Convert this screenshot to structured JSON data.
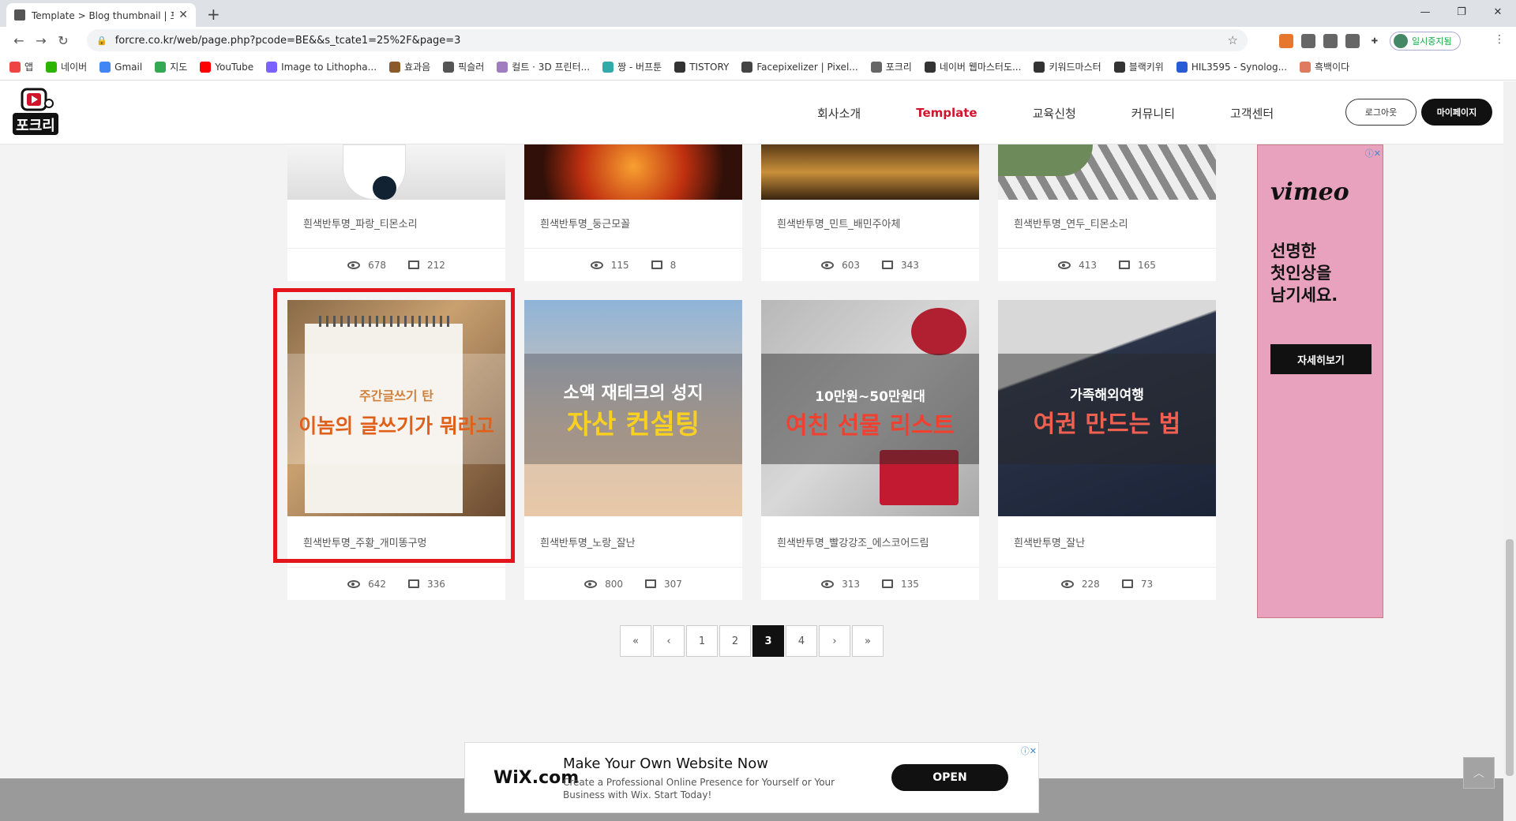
{
  "browser": {
    "tab_title": "Template > Blog thumbnail | 포",
    "url": "forcre.co.kr/web/page.php?pcode=BE&&s_tcate1=25%2F&page=3",
    "profile_label": "일시중지됨",
    "bookmarks": [
      "앱",
      "네이버",
      "Gmail",
      "지도",
      "YouTube",
      "Image to Lithopha...",
      "효과음",
      "픽슬러",
      "컬트 · 3D 프린터...",
      "짱 - 버프툰",
      "TISTORY",
      "Facepixelizer | Pixel...",
      "포크리",
      "네이버 웹마스터도...",
      "키워드마스터",
      "블랙키위",
      "HIL3595 - Synolog...",
      "흑백이다"
    ]
  },
  "site": {
    "logo_text": "포크리",
    "nav": [
      "회사소개",
      "Template",
      "교육신청",
      "커뮤니티",
      "고객센터"
    ],
    "logout": "로그아웃",
    "mypage": "마이페이지"
  },
  "cards_top": [
    {
      "title": "흰색반투명_파랑_티몬소리",
      "views": "678",
      "images": "212"
    },
    {
      "title": "흰색반투명_둥근모꼴",
      "views": "115",
      "images": "8"
    },
    {
      "title": "흰색반투명_민트_배민주아체",
      "views": "603",
      "images": "343"
    },
    {
      "title": "흰색반투명_연두_티몬소리",
      "views": "413",
      "images": "165"
    }
  ],
  "cards_bottom": [
    {
      "title": "흰색반투명_주황_개미똥구멍",
      "views": "642",
      "images": "336",
      "sub": "주간글쓰기 탄",
      "main": "이놈의 글쓰기가 뭐라고"
    },
    {
      "title": "흰색반투명_노랑_잘난",
      "views": "800",
      "images": "307",
      "sub": "소액 재테크의 성지",
      "main": "자산 컨설팅"
    },
    {
      "title": "흰색반투명_빨강강조_에스코어드림",
      "views": "313",
      "images": "135",
      "sub": "10만원~50만원대",
      "main": "여친 선물 리스트"
    },
    {
      "title": "흰색반투명_잘난",
      "views": "228",
      "images": "73",
      "sub": "가족해외여행",
      "main": "여권 만드는 법"
    }
  ],
  "pagination": {
    "first": "«",
    "prev": "‹",
    "pages": [
      "1",
      "2",
      "3",
      "4"
    ],
    "current": "3",
    "next": "›",
    "last": "»"
  },
  "ad_side": {
    "brand": "vimeo",
    "copy1": "선명한",
    "copy2": "첫인상을",
    "copy3": "남기세요.",
    "cta": "자세히보기"
  },
  "ad_bottom": {
    "brand": "WiX.com",
    "headline": "Make Your Own Website Now",
    "desc": "Create a Professional Online Presence for Yourself or Your Business with Wix. Start Today!",
    "cta": "OPEN"
  },
  "colors": {
    "accent": "#d0142c",
    "highlight": "#e3141c"
  }
}
